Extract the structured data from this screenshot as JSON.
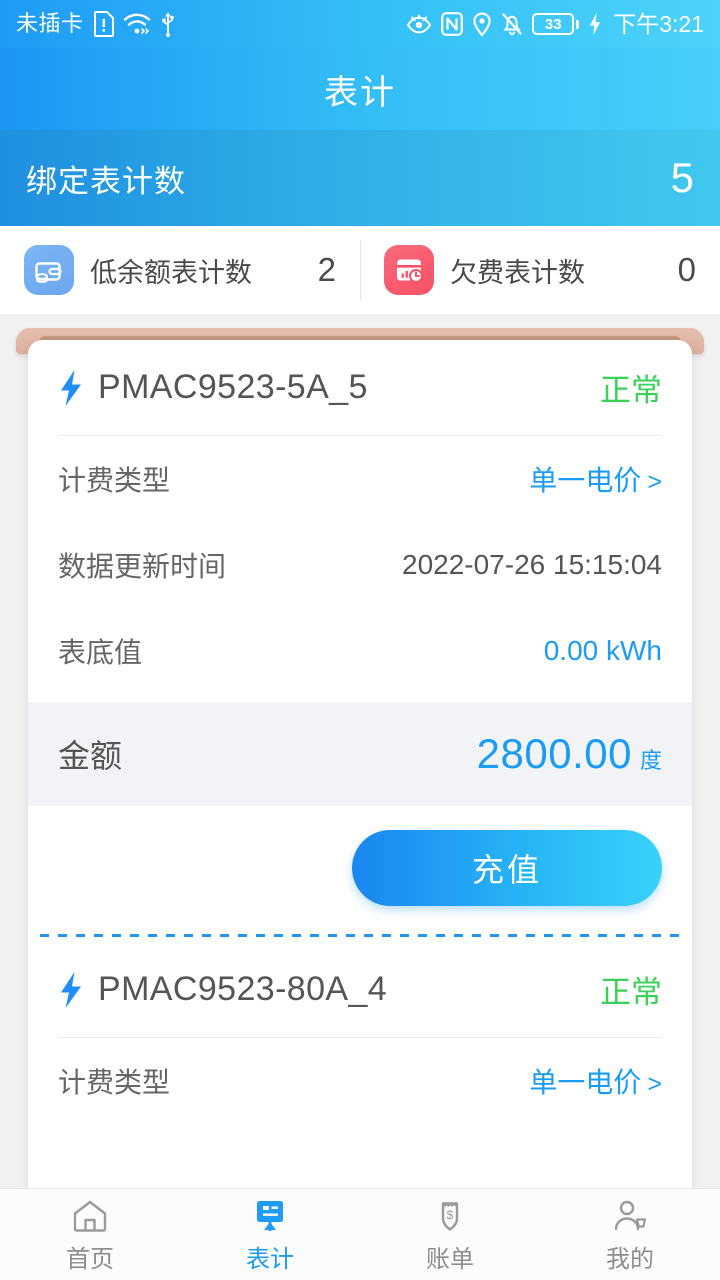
{
  "statusbar": {
    "carrier": "未插卡",
    "icons_left": [
      "sim-alert-icon",
      "wifi-icon",
      "usb-icon"
    ],
    "icons_right": [
      "eye-comfort-icon",
      "nfc-icon",
      "location-icon",
      "mute-icon"
    ],
    "battery_level": "33",
    "charging": true,
    "time": "下午3:21"
  },
  "header": {
    "title": "表计"
  },
  "bound": {
    "label": "绑定表计数",
    "value": "5"
  },
  "stats": [
    {
      "icon": "wallet-icon",
      "label": "低余额表计数",
      "value": "2",
      "color": "#6ba6ef"
    },
    {
      "icon": "overdue-bill-icon",
      "label": "欠费表计数",
      "value": "0",
      "color": "#f85165"
    }
  ],
  "meters": [
    {
      "icon": "lightning-bolt-icon",
      "name": "PMAC9523-5A_5",
      "status": "正常",
      "status_color": "#3ad159",
      "rows": [
        {
          "key": "计费类型",
          "value": "单一电价",
          "style": "link",
          "chevron": ">"
        },
        {
          "key": "数据更新时间",
          "value": "2022-07-26 15:15:04",
          "style": "plain"
        },
        {
          "key": "表底值",
          "value": "0.00 kWh",
          "style": "accent"
        }
      ],
      "amount": {
        "label": "金额",
        "value": "2800.00",
        "unit": "度"
      },
      "recharge_label": "充值"
    },
    {
      "icon": "lightning-bolt-icon",
      "name": "PMAC9523-80A_4",
      "status": "正常",
      "status_color": "#3ad159",
      "rows": [
        {
          "key": "计费类型",
          "value": "单一电价",
          "style": "link",
          "chevron": ">"
        }
      ]
    }
  ],
  "tabbar": [
    {
      "icon": "home-icon",
      "label": "首页",
      "active": false
    },
    {
      "icon": "meter-icon",
      "label": "表计",
      "active": true
    },
    {
      "icon": "bill-icon",
      "label": "账单",
      "active": false
    },
    {
      "icon": "profile-icon",
      "label": "我的",
      "active": false
    }
  ],
  "colors": {
    "accent": "#1a9cf5",
    "header_gradient_start": "#1b97f4",
    "header_gradient_end": "#47cff9",
    "status_ok": "#3ad159",
    "peach_tab": "#dcb09f"
  }
}
